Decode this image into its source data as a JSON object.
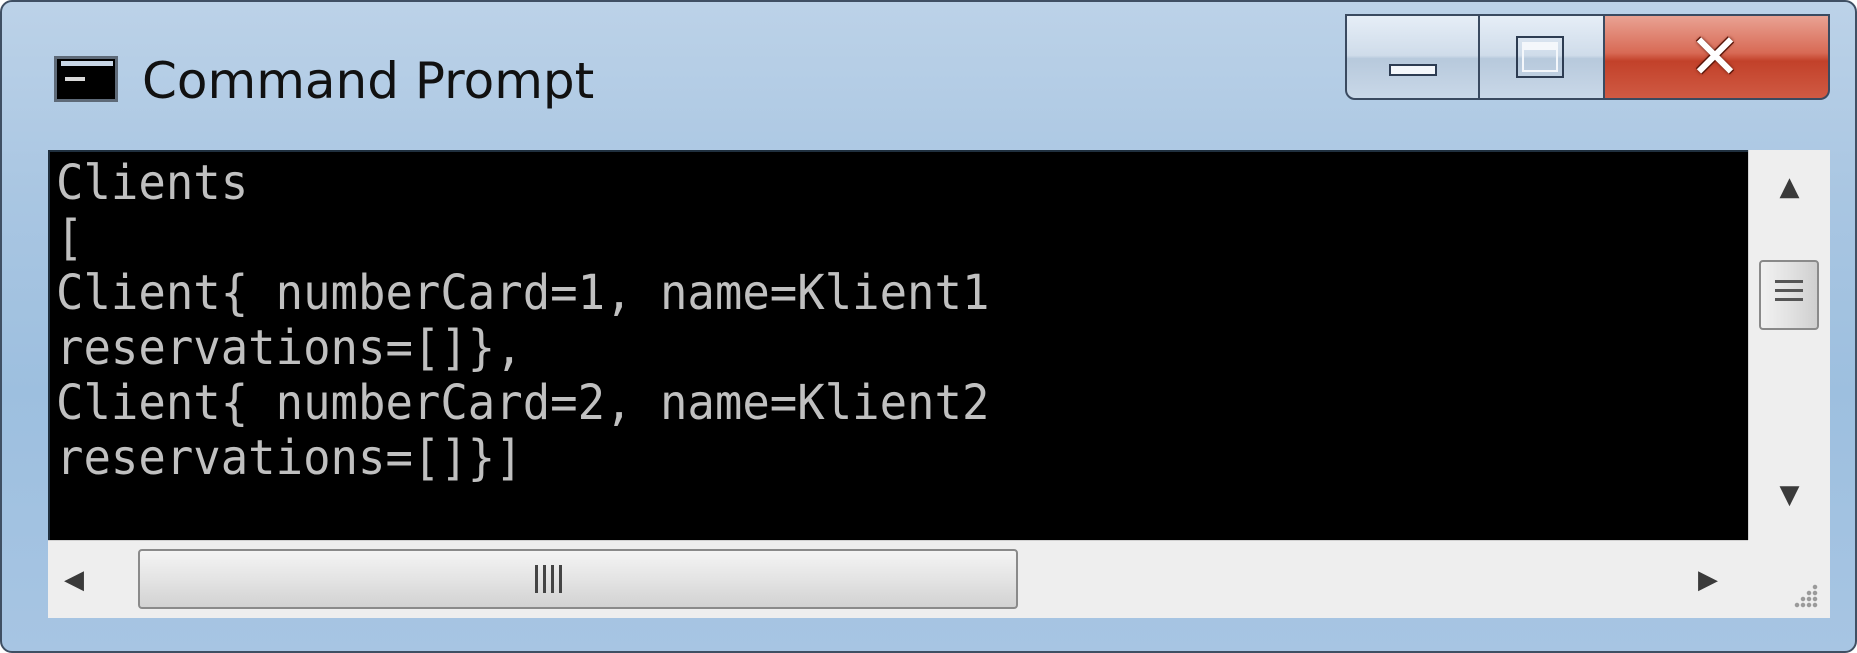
{
  "window": {
    "title": "Command Prompt"
  },
  "title_icons": {
    "app": "cmd-icon",
    "minimize": "minimize-icon",
    "maximize": "maximize-icon",
    "close": "close-icon"
  },
  "console": {
    "lines": [
      "Clients",
      "[",
      "Client{ numberCard=1, name=Klient1",
      "reservations=[]},",
      "Client{ numberCard=2, name=Klient2",
      "reservations=[]}]"
    ]
  },
  "scrollbars": {
    "vertical_position": 0.2,
    "horizontal_position": 0.0
  },
  "colors": {
    "console_background": "#000000",
    "console_text": "#c0c0c0",
    "close_button": "#c7432c"
  }
}
